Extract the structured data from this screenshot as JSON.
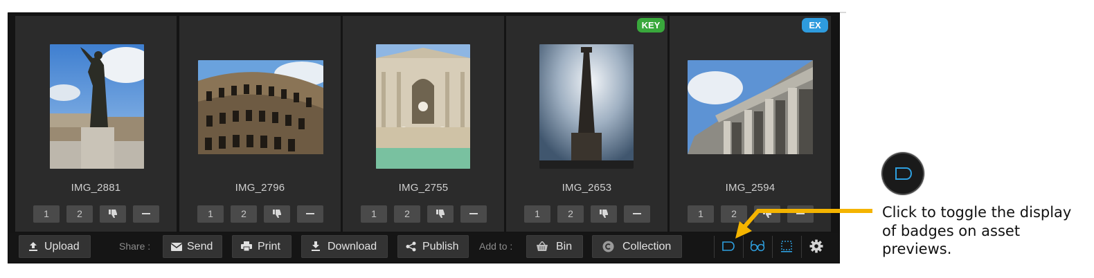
{
  "assets": [
    {
      "name": "IMG_2881",
      "badge": "",
      "ratings": [
        "1",
        "2"
      ]
    },
    {
      "name": "IMG_2796",
      "badge": "",
      "ratings": [
        "1",
        "2"
      ]
    },
    {
      "name": "IMG_2755",
      "badge": "",
      "ratings": [
        "1",
        "2"
      ]
    },
    {
      "name": "IMG_2653",
      "badge": "KEY",
      "ratings": [
        "1",
        "2"
      ]
    },
    {
      "name": "IMG_2594",
      "badge": "EX",
      "ratings": [
        "1",
        "2"
      ]
    }
  ],
  "toolbar": {
    "upload": "Upload",
    "share_label": "Share :",
    "send": "Send",
    "print": "Print",
    "download": "Download",
    "publish": "Publish",
    "add_to_label": "Add to :",
    "bin": "Bin",
    "collection": "Collection"
  },
  "callout": {
    "text": "Click to toggle the display of badges on asset previews."
  },
  "colors": {
    "key_badge": "#39a83c",
    "ex_badge": "#2e9bde",
    "toggle_icon": "#2ea0e0",
    "arrow": "#f4b400"
  },
  "icons": [
    "upload-icon",
    "envelope-icon",
    "printer-icon",
    "download-icon",
    "share-icon",
    "basket-icon",
    "collection-icon",
    "badge-toggle-icon",
    "glasses-icon",
    "selection-icon",
    "gear-icon",
    "thumbs-down-icon",
    "minus-icon"
  ]
}
